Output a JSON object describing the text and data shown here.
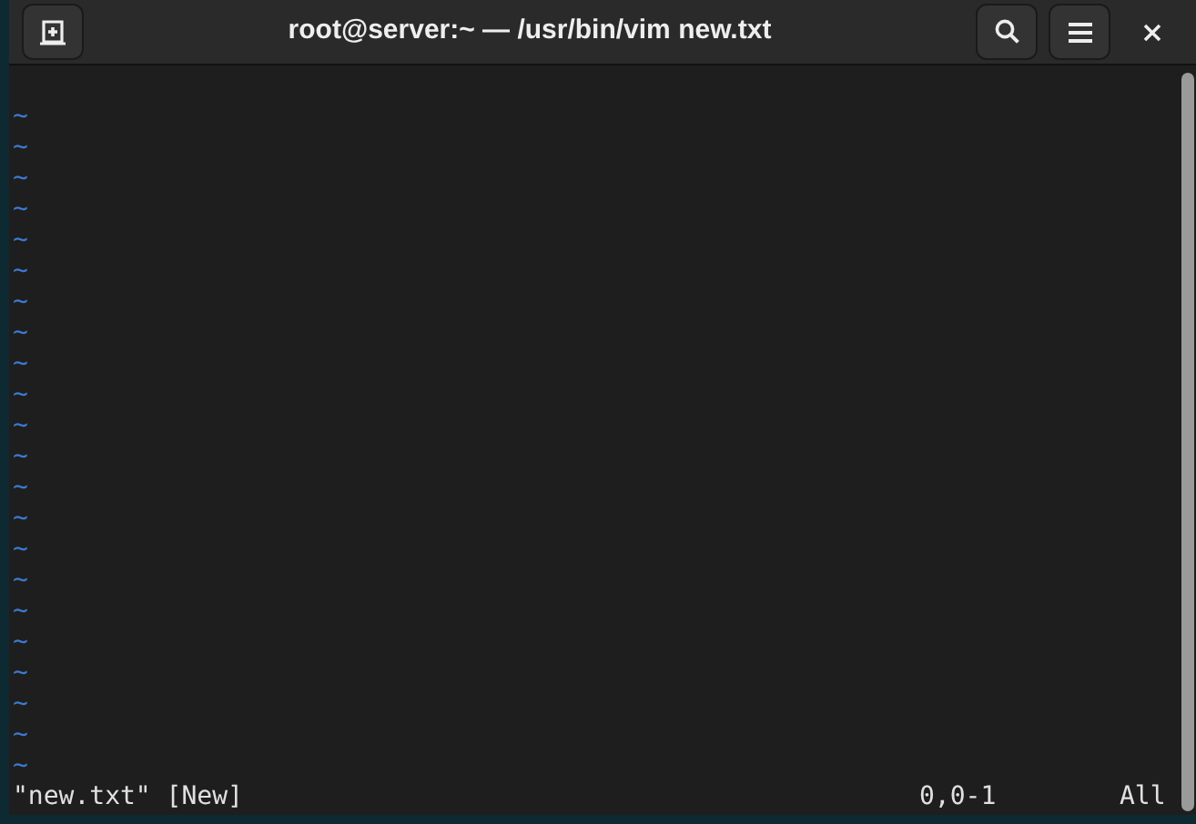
{
  "window": {
    "title": "root@server:~ — /usr/bin/vim new.txt"
  },
  "editor": {
    "lines": [
      "~",
      "~",
      "~",
      "~",
      "~",
      "~",
      "~",
      "~",
      "~",
      "~",
      "~",
      "~",
      "~",
      "~",
      "~",
      "~",
      "~",
      "~",
      "~",
      "~",
      "~",
      "~"
    ]
  },
  "status_line": {
    "message": "\"new.txt\" [New]",
    "position": "0,0-1",
    "scroll": "All"
  }
}
